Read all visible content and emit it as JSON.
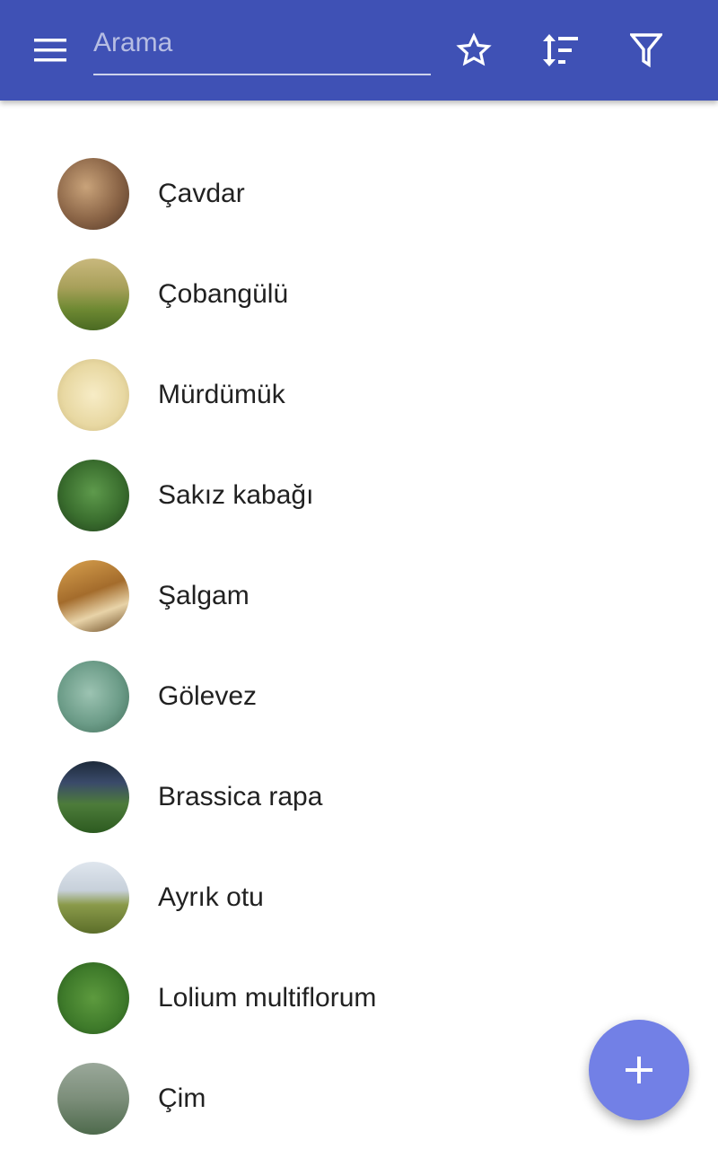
{
  "appbar": {
    "search_placeholder": "Arama",
    "search_value": "",
    "color": "#3f51b5"
  },
  "icons": {
    "menu": "menu-icon",
    "favorite": "star-outline-icon",
    "sort": "sort-icon",
    "filter": "filter-icon",
    "add": "plus-icon"
  },
  "items": [
    {
      "label": "Çavdar",
      "thumb": "t-cavdar"
    },
    {
      "label": "Çobangülü",
      "thumb": "t-coban"
    },
    {
      "label": "Mürdümük",
      "thumb": "t-murdum"
    },
    {
      "label": "Sakız kabağı",
      "thumb": "t-sakiz"
    },
    {
      "label": "Şalgam",
      "thumb": "t-salgam"
    },
    {
      "label": "Gölevez",
      "thumb": "t-golev"
    },
    {
      "label": "Brassica rapa",
      "thumb": "t-bras"
    },
    {
      "label": "Ayrık otu",
      "thumb": "t-ayrik"
    },
    {
      "label": "Lolium multiflorum",
      "thumb": "t-lolium"
    },
    {
      "label": "Çim",
      "thumb": "t-cim"
    }
  ],
  "fab": {
    "color": "#7280e6"
  }
}
